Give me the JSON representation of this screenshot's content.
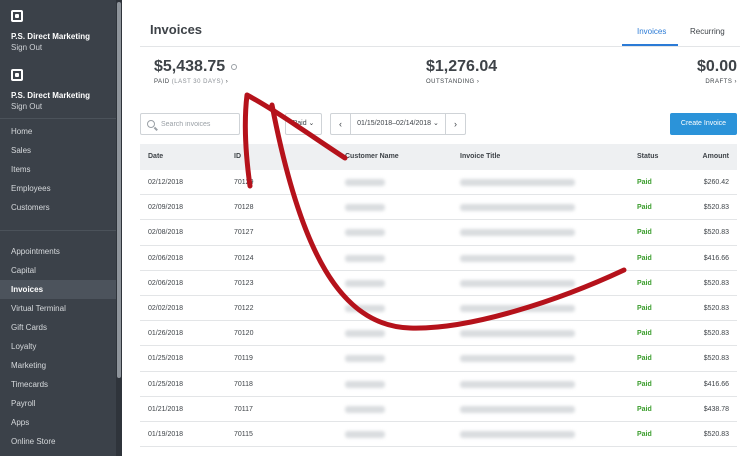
{
  "sidebar": {
    "business_name": "P.S. Direct Marketing",
    "sign_out": "Sign Out",
    "nav_primary": [
      "Home",
      "Sales",
      "Items",
      "Employees",
      "Customers"
    ],
    "nav_secondary": [
      "Appointments",
      "Capital",
      "Invoices",
      "Virtual Terminal",
      "Gift Cards",
      "Loyalty",
      "Marketing",
      "Timecards",
      "Payroll",
      "Apps",
      "Online Store"
    ],
    "active_item": "Invoices"
  },
  "header": {
    "title": "Invoices",
    "tabs": [
      {
        "label": "Invoices",
        "active": true
      },
      {
        "label": "Recurring",
        "active": false
      }
    ]
  },
  "stats": {
    "paid": {
      "amount": "$5,438.75",
      "label": "PAID",
      "sub": "(LAST 30 DAYS)",
      "chevron": "›"
    },
    "outstanding": {
      "amount": "$1,276.04",
      "label": "OUTSTANDING",
      "chevron": "›"
    },
    "drafts": {
      "amount": "$0.00",
      "label": "DRAFTS",
      "chevron": "›"
    }
  },
  "toolbar": {
    "search_placeholder": "Search invoices",
    "status_filter": "Paid",
    "date_range": "01/15/2018–02/14/2018",
    "create_label": "Create Invoice"
  },
  "table": {
    "columns": [
      "Date",
      "ID",
      "Customer Name",
      "Invoice Title",
      "Status",
      "Amount"
    ],
    "rows": [
      {
        "date": "02/12/2018",
        "id": "70129",
        "status": "Paid",
        "amount": "$260.42"
      },
      {
        "date": "02/09/2018",
        "id": "70128",
        "status": "Paid",
        "amount": "$520.83"
      },
      {
        "date": "02/08/2018",
        "id": "70127",
        "status": "Paid",
        "amount": "$520.83"
      },
      {
        "date": "02/06/2018",
        "id": "70124",
        "status": "Paid",
        "amount": "$416.66"
      },
      {
        "date": "02/06/2018",
        "id": "70123",
        "status": "Paid",
        "amount": "$520.83"
      },
      {
        "date": "02/02/2018",
        "id": "70122",
        "status": "Paid",
        "amount": "$520.83"
      },
      {
        "date": "01/26/2018",
        "id": "70120",
        "status": "Paid",
        "amount": "$520.83"
      },
      {
        "date": "01/25/2018",
        "id": "70119",
        "status": "Paid",
        "amount": "$520.83"
      },
      {
        "date": "01/25/2018",
        "id": "70118",
        "status": "Paid",
        "amount": "$416.66"
      },
      {
        "date": "01/21/2018",
        "id": "70117",
        "status": "Paid",
        "amount": "$438.78"
      },
      {
        "date": "01/19/2018",
        "id": "70115",
        "status": "Paid",
        "amount": "$520.83"
      }
    ]
  },
  "colors": {
    "sidebar_bg": "#3b4149",
    "accent": "#2b93d9",
    "paid_green": "#3a9d2c",
    "annotation_red": "#b5121b"
  },
  "icons": {
    "logo": "square-logo-icon",
    "search": "search-icon",
    "filter_chevron": "chevron-down-icon",
    "prev": "chevron-left-icon",
    "next": "chevron-right-icon"
  }
}
